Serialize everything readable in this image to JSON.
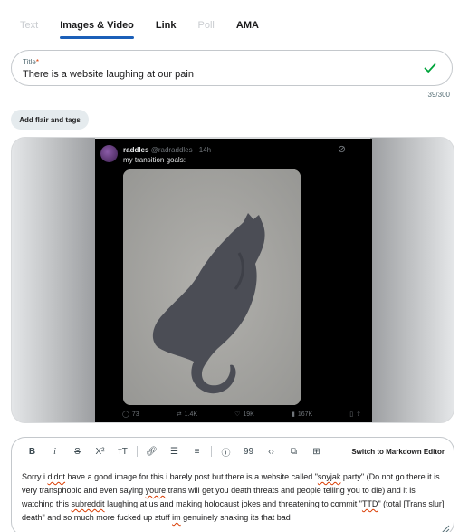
{
  "tabs": [
    {
      "label": "Text",
      "state": "disabled"
    },
    {
      "label": "Images & Video",
      "state": "active"
    },
    {
      "label": "Link",
      "state": "normal"
    },
    {
      "label": "Poll",
      "state": "disabled"
    },
    {
      "label": "AMA",
      "state": "normal"
    }
  ],
  "title_field": {
    "label": "Title",
    "required_mark": "*",
    "value": "There is a website laughing at our pain",
    "counter": "39/300",
    "status_icon": "check-icon"
  },
  "flair_button": "Add flair and tags",
  "embedded_post": {
    "display_name": "raddles",
    "handle_and_time": "@radraddles · 14h",
    "text": "my transition goals:",
    "actions": {
      "replies": "73",
      "reposts": "1.4K",
      "likes": "19K",
      "views": "167K"
    }
  },
  "editor": {
    "markdown_switch": "Switch to Markdown Editor",
    "toolbar_icons": [
      "bold-icon",
      "italic-icon",
      "strikethrough-icon",
      "superscript-icon",
      "heading-icon",
      "link-icon",
      "bulleted-list-icon",
      "numbered-list-icon",
      "spoiler-icon",
      "quote-icon",
      "code-icon",
      "code-block-icon",
      "table-icon"
    ],
    "body": {
      "s1": "Sorry i ",
      "w1": "didnt",
      "s2": " have a good image for this i barely post but there is a website called \"",
      "w2": "soyjak",
      "s3": " party\" (Do not go there it is very transphobic and even saying ",
      "w3": "youre",
      "s4": " trans will get you death threats and people telling you to die) and it is watching this ",
      "w4": "subreddit",
      "s5": " laughing at us and making holocaust jokes and threatening to commit \"",
      "w5": "TTD",
      "s6": "\" (total [Trans slur] death\" and so much more fucked up stuff ",
      "w6": "im",
      "s7": " genuinely shaking its that bad"
    }
  },
  "colors": {
    "accent_tab": "#1b5fb8",
    "required": "#d93a00",
    "check": "#00a43b"
  }
}
